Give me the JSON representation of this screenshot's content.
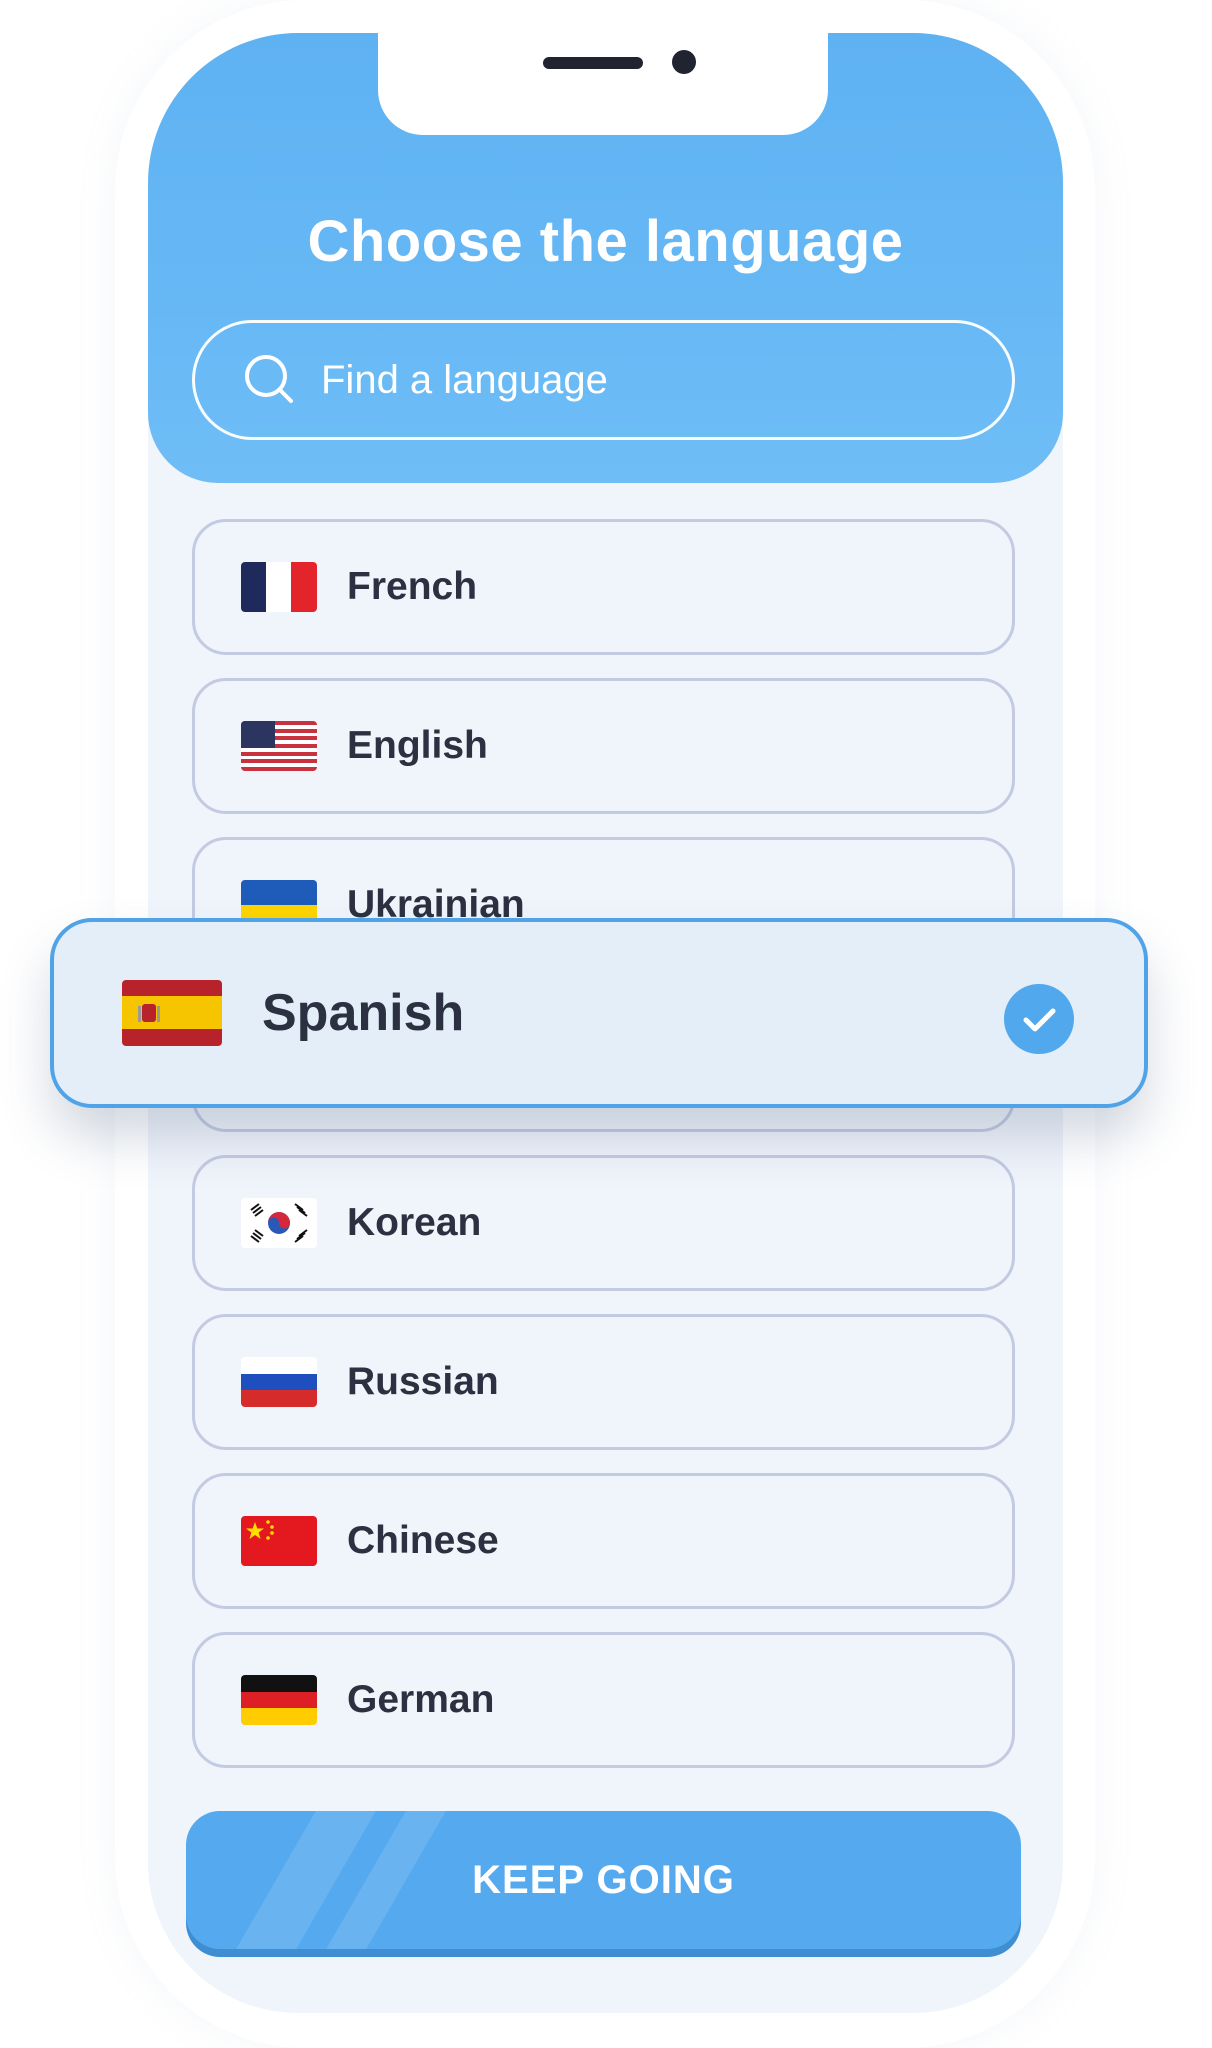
{
  "header": {
    "title": "Choose the language"
  },
  "search": {
    "placeholder": "Find a language",
    "icon": "search-icon"
  },
  "languages": [
    {
      "label": "French",
      "flag": "france-flag-icon"
    },
    {
      "label": "English",
      "flag": "usa-flag-icon"
    },
    {
      "label": "Ukrainian",
      "flag": "ukraine-flag-icon"
    },
    {
      "label": "Korean",
      "flag": "south-korea-flag-icon"
    },
    {
      "label": "Russian",
      "flag": "russia-flag-icon"
    },
    {
      "label": "Chinese",
      "flag": "china-flag-icon"
    },
    {
      "label": "German",
      "flag": "germany-flag-icon"
    }
  ],
  "selected": {
    "label": "Spanish",
    "flag": "spain-flag-icon",
    "check_icon": "check-circle-icon"
  },
  "cta": {
    "label": "KEEP GOING"
  },
  "colors": {
    "accent": "#5fb2f2",
    "list_background": "#f0f4fb",
    "item_border": "#c3cbe2",
    "text": "#2b3140",
    "selected_background": "#e4eef9",
    "selected_border": "#4fa3e6"
  }
}
